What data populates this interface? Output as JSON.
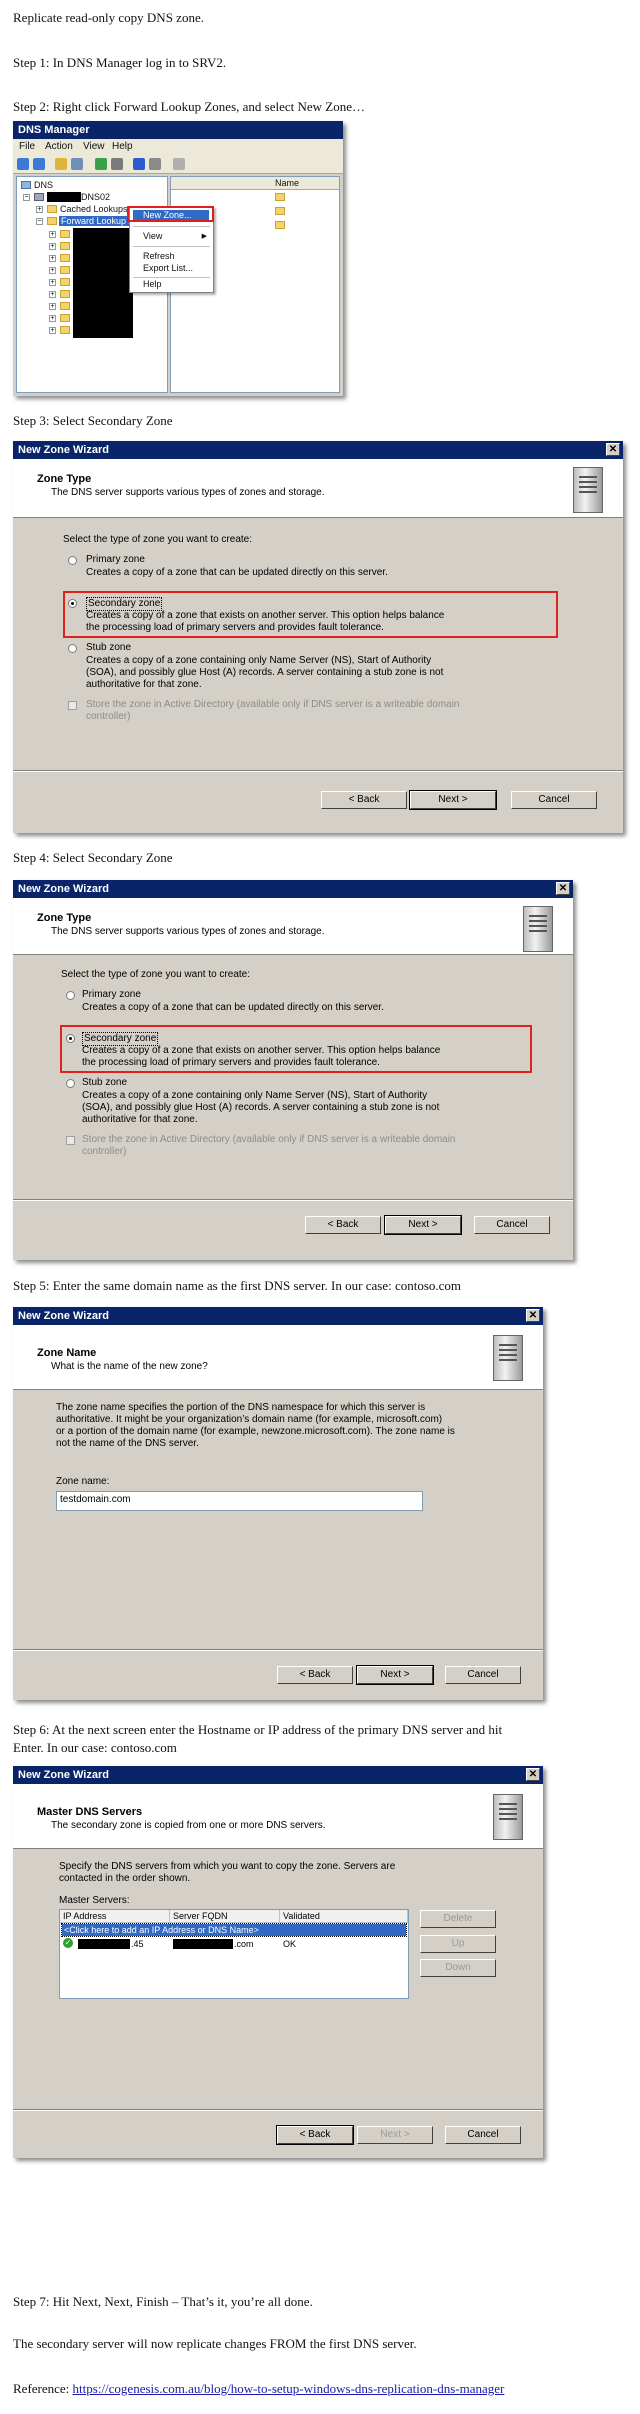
{
  "doc": {
    "intro": "Replicate read-only copy DNS zone.",
    "step1": "Step 1: In DNS Manager log in to SRV2.",
    "step2": "Step 2: Right click Forward Lookup Zones, and select New Zone…",
    "step3": "Step 3: Select Secondary Zone",
    "step4": "Step 4: Select Secondary Zone",
    "step5": "Step 5: Enter the same domain name as the first DNS server. In our case: contoso.com",
    "step6_line1": "Step 6: At the next screen enter the Hostname or IP address of the primary DNS server and hit",
    "step6_line2": "Enter. In our case: contoso.com",
    "step7": "Step 7: Hit Next, Next, Finish – That’s it, you’re all done.",
    "closing": "The secondary server will now replicate changes FROM the first DNS server.",
    "reference_label": "Reference: ",
    "reference_url": "https://cogenesis.com.au/blog/how-to-setup-windows-dns-replication-dns-manager"
  },
  "dns_manager": {
    "title": "DNS Manager",
    "menu": [
      "File",
      "Action",
      "View",
      "Help"
    ],
    "tree": {
      "root": "DNS",
      "server_suffix": "DNS02",
      "cached": "Cached Lookups",
      "forward": "Forward Lookup Zones"
    },
    "right_col_header": "Name",
    "context_menu": {
      "new_zone": "New Zone...",
      "view": "View",
      "refresh": "Refresh",
      "export": "Export List...",
      "help": "Help"
    }
  },
  "zone_type_wizard": {
    "title": "New Zone Wizard",
    "header_title": "Zone Type",
    "header_sub": "The DNS server supports various types of zones and storage.",
    "prompt": "Select the type of zone you want to create:",
    "primary_label": "Primary zone",
    "primary_desc": "Creates a copy of a zone that can be updated directly on this server.",
    "secondary_label": "Secondary zone",
    "secondary_desc1": "Creates a copy of a zone that exists on another server. This option helps balance",
    "secondary_desc2": "the processing load of primary servers and provides fault tolerance.",
    "stub_label": "Stub zone",
    "stub_desc1": "Creates a copy of a zone containing only Name Server (NS), Start of Authority",
    "stub_desc2": "(SOA), and possibly glue Host (A) records. A server containing a stub zone is not",
    "stub_desc3": "authoritative for that zone.",
    "ad_label1": "Store the zone in Active Directory (available only if DNS server is a writeable domain",
    "ad_label2": "controller)",
    "back": "< Back",
    "next": "Next >",
    "cancel": "Cancel"
  },
  "zone_name_wizard": {
    "title": "New Zone Wizard",
    "header_title": "Zone Name",
    "header_sub": "What is the name of the new zone?",
    "desc1": "The zone name specifies the portion of the DNS namespace for which this server is",
    "desc2": "authoritative. It might be your organization’s domain name (for example, microsoft.com)",
    "desc3": "or a portion of the domain name (for example, newzone.microsoft.com). The zone name is",
    "desc4": "not the name of the DNS server.",
    "zone_label": "Zone name:",
    "zone_value": "testdomain.com",
    "back": "< Back",
    "next": "Next >",
    "cancel": "Cancel"
  },
  "master_wizard": {
    "title": "New Zone Wizard",
    "header_title": "Master DNS Servers",
    "header_sub": "The secondary zone is copied from one or more DNS servers.",
    "desc1": "Specify the DNS servers from which you want to copy the zone.  Servers are",
    "desc2": "contacted in the order shown.",
    "list_label": "Master Servers:",
    "columns": [
      "IP Address",
      "Server FQDN",
      "Validated"
    ],
    "add_row": "<Click here to add an IP Address or DNS Name>",
    "row_ip_suffix": ".45",
    "row_fqdn_suffix": ".com",
    "row_status": "OK",
    "delete": "Delete",
    "up": "Up",
    "down": "Down",
    "back": "< Back",
    "next": "Next >",
    "cancel": "Cancel"
  }
}
